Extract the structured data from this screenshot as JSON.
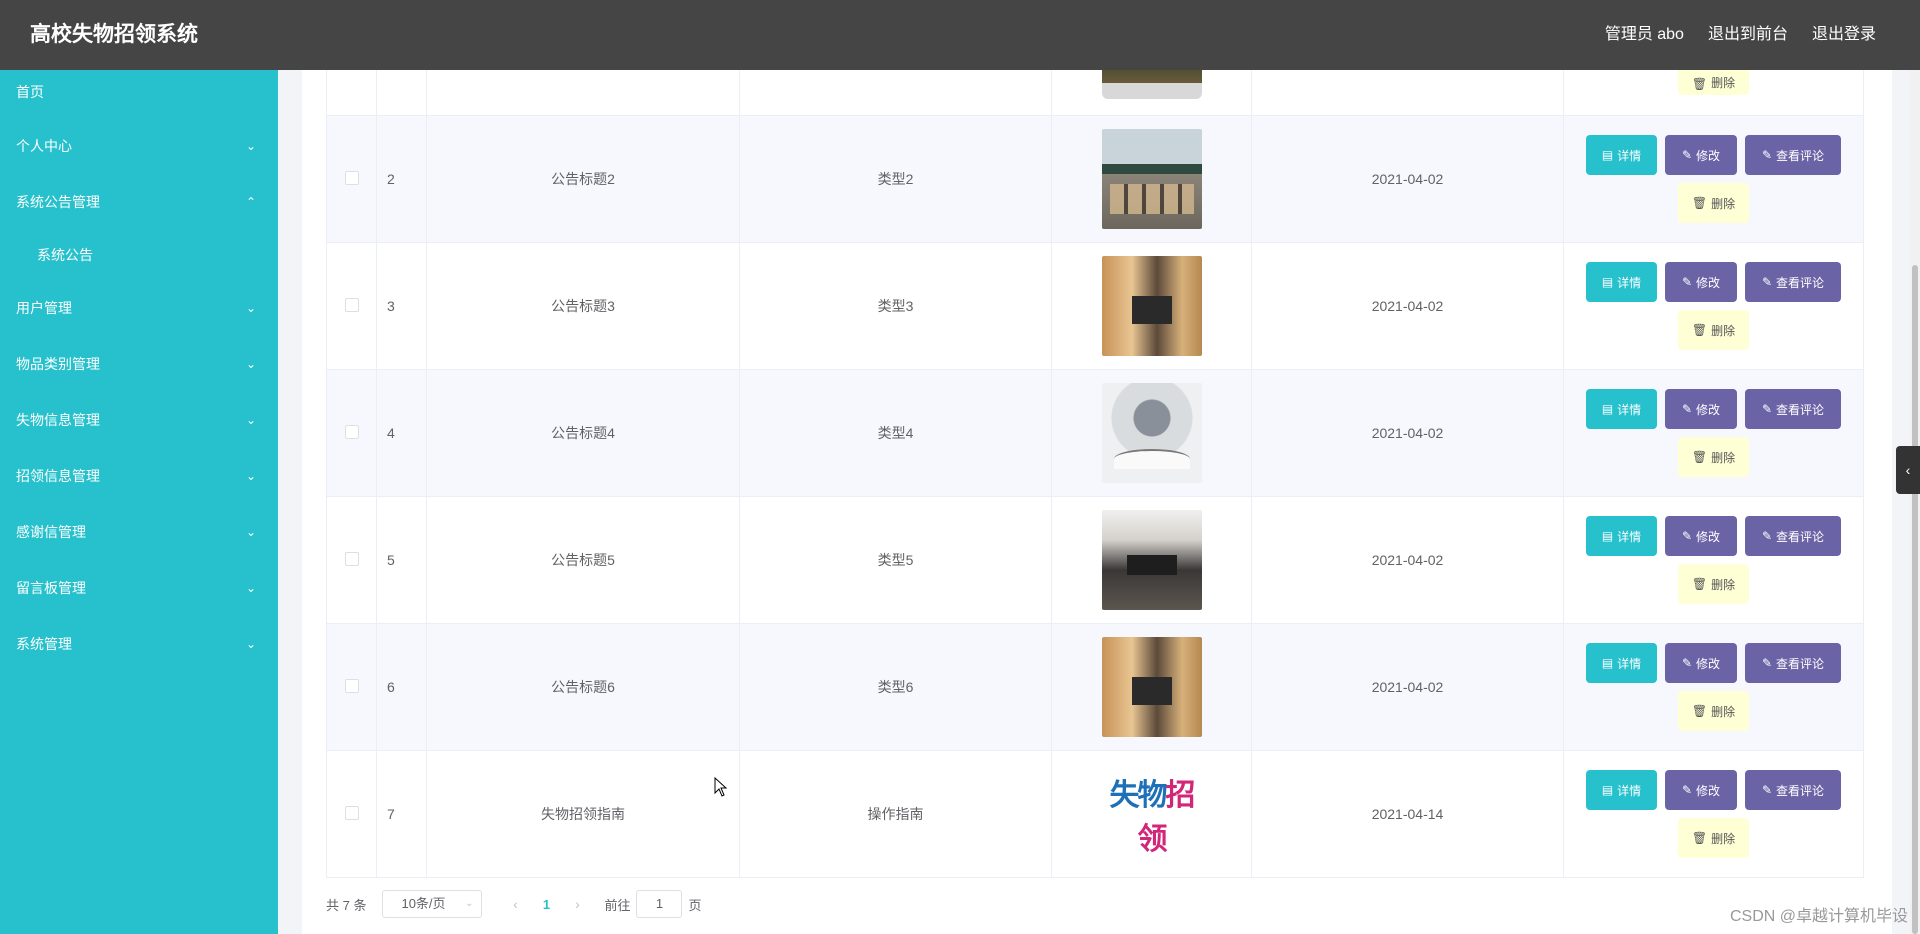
{
  "app_title": "高校失物招领系统",
  "header": {
    "user": "管理员 abo",
    "to_front": "退出到前台",
    "logout": "退出登录"
  },
  "sidebar": {
    "items": [
      {
        "label": "首页",
        "arrow": ""
      },
      {
        "label": "个人中心",
        "arrow": "⌄"
      },
      {
        "label": "系统公告管理",
        "arrow": "⌃"
      },
      {
        "label": "系统公告",
        "arrow": ""
      },
      {
        "label": "用户管理",
        "arrow": "⌄"
      },
      {
        "label": "物品类别管理",
        "arrow": "⌄"
      },
      {
        "label": "失物信息管理",
        "arrow": "⌄"
      },
      {
        "label": "招领信息管理",
        "arrow": "⌄"
      },
      {
        "label": "感谢信管理",
        "arrow": "⌄"
      },
      {
        "label": "留言板管理",
        "arrow": "⌄"
      },
      {
        "label": "系统管理",
        "arrow": "⌄"
      }
    ]
  },
  "buttons": {
    "detail": "详情",
    "edit": "修改",
    "comment": "查看评论",
    "delete": "删除"
  },
  "rows": [
    {
      "index": "2",
      "title": "公告标题2",
      "type": "类型2",
      "image": "classroom",
      "date": "2021-04-02"
    },
    {
      "index": "3",
      "title": "公告标题3",
      "type": "类型3",
      "image": "dorm",
      "date": "2021-04-02"
    },
    {
      "index": "4",
      "title": "公告标题4",
      "type": "类型4",
      "image": "book",
      "date": "2021-04-02"
    },
    {
      "index": "5",
      "title": "公告标题5",
      "type": "类型5",
      "image": "office",
      "date": "2021-04-02"
    },
    {
      "index": "6",
      "title": "公告标题6",
      "type": "类型6",
      "image": "dorm",
      "date": "2021-04-02"
    },
    {
      "index": "7",
      "title": "失物招领指南",
      "type": "操作指南",
      "image": "logo",
      "date": "2021-04-14"
    }
  ],
  "logo_text": {
    "part1": "失物",
    "part2": "招领"
  },
  "pagination": {
    "total": "共 7 条",
    "page_size": "10条/页",
    "current": "1",
    "goto_prefix": "前往",
    "goto_value": "1",
    "goto_suffix": "页"
  },
  "watermark": "CSDN @卓越计算机毕设"
}
